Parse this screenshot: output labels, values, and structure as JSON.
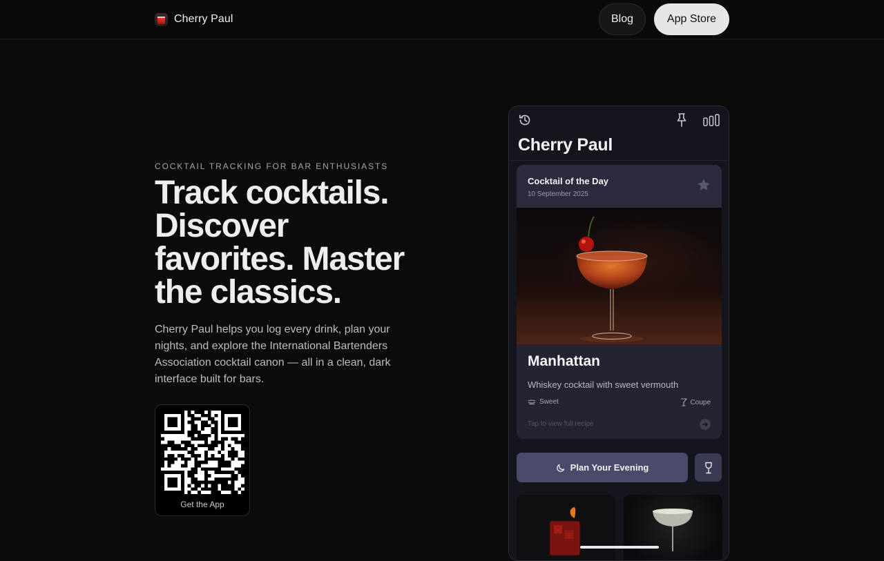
{
  "nav": {
    "brand": "Cherry Paul",
    "links": [
      {
        "label": "Blog"
      },
      {
        "label": "App Store"
      }
    ]
  },
  "hero": {
    "eyebrow": "COCKTAIL TRACKING FOR BAR ENTHUSIASTS",
    "headline": "Track cocktails. Discover favorites. Master the classics.",
    "description": "Cherry Paul helps you log every drink, plan your nights, and explore the International Bartenders Association cocktail canon — all in a clean, dark interface built for bars.",
    "qr_caption": "Get the App"
  },
  "phone": {
    "app_title": "Cherry Paul",
    "top_icons": [
      "history-icon",
      "pin-icon",
      "stats-icon"
    ],
    "cocktail_of_the_day": {
      "heading": "Cocktail of the Day",
      "date": "10 September 2025",
      "name": "Manhattan",
      "description": "Whiskey cocktail with sweet vermouth",
      "taste": "Sweet",
      "glass": "Coupe",
      "tap_hint": "Tap to view full recipe"
    },
    "plan_button": "Plan Your Evening"
  },
  "colors": {
    "background": "#0b0b0c",
    "phone_background": "#15151e",
    "card_background": "#232333",
    "plan_button": "#4a4a6a",
    "app_store_button": "#e6e6e6"
  }
}
